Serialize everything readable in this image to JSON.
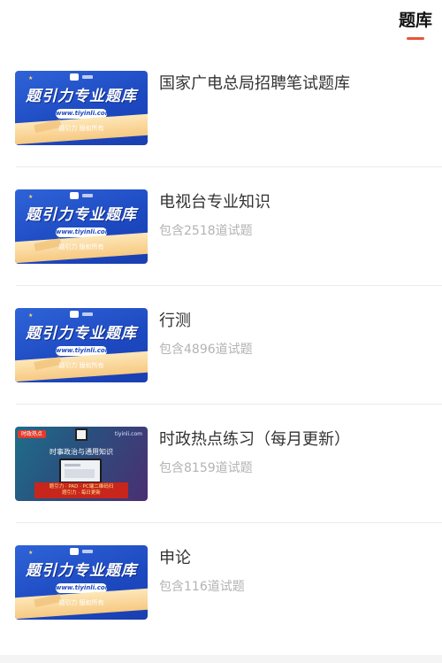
{
  "tabbar": {
    "active_tab": "题库"
  },
  "thumbnails": {
    "banner": {
      "brand": "题引力专业题库",
      "url": "www.tiyinli.com",
      "copyright": "题引力 版权所有"
    },
    "course": {
      "tag": "时政热点",
      "site": "tiyinli.com",
      "heading": "时事政治与通用知识",
      "band_line_1": "题引力 · PAD · PC端二维码扫",
      "band_line_2": "题引力 · 每日更新"
    }
  },
  "colors": {
    "accent": "#e8543a",
    "title": "#333333",
    "subtitle": "#b3b3b3"
  },
  "items": [
    {
      "title": "国家广电总局招聘笔试题库",
      "subtitle": "",
      "thumbnail": "banner"
    },
    {
      "title": "电视台专业知识",
      "subtitle": "包含2518道试题",
      "thumbnail": "banner"
    },
    {
      "title": "行测",
      "subtitle": "包含4896道试题",
      "thumbnail": "banner"
    },
    {
      "title": "时政热点练习（每月更新）",
      "subtitle": "包含8159道试题",
      "thumbnail": "course"
    },
    {
      "title": "申论",
      "subtitle": "包含116道试题",
      "thumbnail": "banner"
    }
  ]
}
